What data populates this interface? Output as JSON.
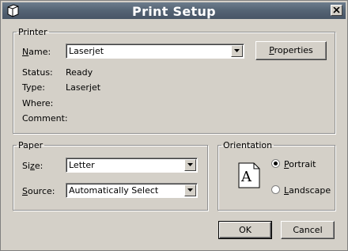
{
  "window": {
    "title": "Print Setup"
  },
  "printer": {
    "group_label": "Printer",
    "name_label": "Name:",
    "name_value": "Laserjet",
    "properties_label": "Properties",
    "status_label": "Status:",
    "status_value": "Ready",
    "type_label": "Type:",
    "type_value": "Laserjet",
    "where_label": "Where:",
    "where_value": "",
    "comment_label": "Comment:",
    "comment_value": ""
  },
  "paper": {
    "group_label": "Paper",
    "size_label": "Size:",
    "size_value": "Letter",
    "source_label": "Source:",
    "source_value": "Automatically Select"
  },
  "orientation": {
    "group_label": "Orientation",
    "preview_letter": "A",
    "portrait_label": "Portrait",
    "landscape_label": "Landscape",
    "selected": "portrait"
  },
  "buttons": {
    "ok_label": "OK",
    "cancel_label": "Cancel"
  }
}
